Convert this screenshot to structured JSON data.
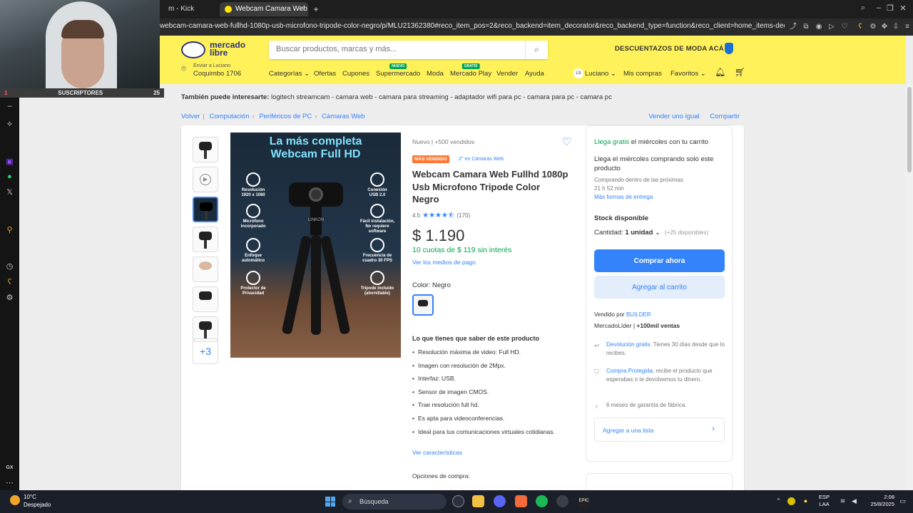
{
  "overlay": {
    "subscribers_label": "SUSCRIPTORES",
    "subscribers_count": "25",
    "subscribers_index": "1"
  },
  "browser": {
    "tab_inactive": "m - Kick Dashboard",
    "tab_active": "Webcam Camara Web Fu",
    "url": "webcam-camara-web-fullhd-1080p-usb-microfono-tripode-color-negro/p/MLU21362380#reco_item_pos=2&reco_backend=item_decorator&reco_backend_type=function&reco_client=home_items-decorator-legacy"
  },
  "header": {
    "logo_line1": "mercado",
    "logo_line2": "libre",
    "search_placeholder": "Buscar productos, marcas y más...",
    "promo": "DESCUENTAZOS DE MODA ACÁ",
    "location_line1": "Enviar a Luciano",
    "location_line2": "Coquimbo 1706",
    "nav": [
      "Categorías",
      "Ofertas",
      "Cupones",
      "Supermercado",
      "Moda",
      "Mercado Play",
      "Vender",
      "Ayuda"
    ],
    "badge_super": "NUEVO",
    "badge_play": "GRATIS",
    "user_initials": "LS",
    "user_name": "Luciano",
    "mis_compras": "Mis compras",
    "favoritos": "Favoritos"
  },
  "related": {
    "label": "También puede interesarte:",
    "items": "logitech streamcam - camara web - camara para streaming - adaptador wifi para pc - camara para pc - camara pc"
  },
  "breadcrumb": {
    "back": "Volver",
    "items": [
      "Computación",
      "Periféricos de PC",
      "Cámaras Web"
    ],
    "sell_same": "Vender uno igual",
    "share": "Compartir"
  },
  "gallery": {
    "more_count": "+3",
    "headline_1": "La más completa",
    "headline_2": "Webcam Full HD",
    "features": [
      {
        "l1": "Resolución",
        "l2": "1920 x 1080"
      },
      {
        "l1": "Micrófono",
        "l2": "incorporado"
      },
      {
        "l1": "Enfoque",
        "l2": "automático"
      },
      {
        "l1": "Protector de",
        "l2": "Privacidad"
      },
      {
        "l1": "Conexión",
        "l2": "USB 2.0"
      },
      {
        "l1": "Fácil instalación,",
        "l2": "No requiere software"
      },
      {
        "l1": "Frecuencia de",
        "l2": "cuadro 30 FPS"
      },
      {
        "l1": "Trípode incluido",
        "l2": "(atornillable)"
      }
    ],
    "brand": "LINKON"
  },
  "product": {
    "condition": "Nuevo  |  +500 vendidos",
    "best_seller": "MÁS VENDIDO",
    "rank": "2° en Cámaras Web",
    "title": "Webcam Camara Web Fullhd 1080p Usb Microfono Tripode Color Negro",
    "rating": "4.5",
    "reviews": "(170)",
    "price": "$ 1.190",
    "installments": "10 cuotas de $ 119 sin interés",
    "payment_link": "Ver los medios de pago",
    "color_label": "Color: ",
    "color_value": "Negro",
    "know_title": "Lo que tienes que saber de este producto",
    "specs": [
      "Resolución máxima de video: Full HD.",
      "Imagen con resolución de 2Mpx.",
      "Interfaz: USB.",
      "Sensor de imagen CMOS.",
      "Trae resolución full hd.",
      "Es apta para videoconferencias.",
      "Ideal para tus comunicaciones virtuales cotidianas."
    ],
    "see_features": "Ver características",
    "buy_options": "Opciones de compra:"
  },
  "buybox": {
    "free_label": "Llega gratis",
    "free_rest": " el miércoles con tu carrito",
    "arrives": "Llega el miércoles comprando solo este producto",
    "buy_within_1": "Comprando dentro de las próximas",
    "buy_within_2": "21 h 52 min",
    "more_delivery": "Más formas de entrega",
    "stock": "Stock disponible",
    "qty_label": "Cantidad: ",
    "qty_value": "1 unidad",
    "qty_avail": "(+25 disponibles)",
    "buy_now": "Comprar ahora",
    "add_cart": "Agregar al carrito",
    "sold_by": "Vendido por ",
    "seller": "BUILDER",
    "leader": "MercadoLíder",
    "sales": "+100mil ventas",
    "return_link": "Devolución gratis",
    "return_rest": ". Tienes 30 días desde que lo recibes.",
    "protect_link": "Compra Protegida",
    "protect_rest": ", recibe el producto que esperabas o te devolvemos tu dinero.",
    "warranty": "6 meses de garantía de fábrica.",
    "add_list": "Agregar a una lista"
  },
  "taskbar": {
    "temp": "10°C",
    "weather": "Despejado",
    "search": "Búsqueda",
    "lang_1": "ESP",
    "lang_2": "LAA",
    "time": "2:08",
    "date": "25/8/2025"
  }
}
